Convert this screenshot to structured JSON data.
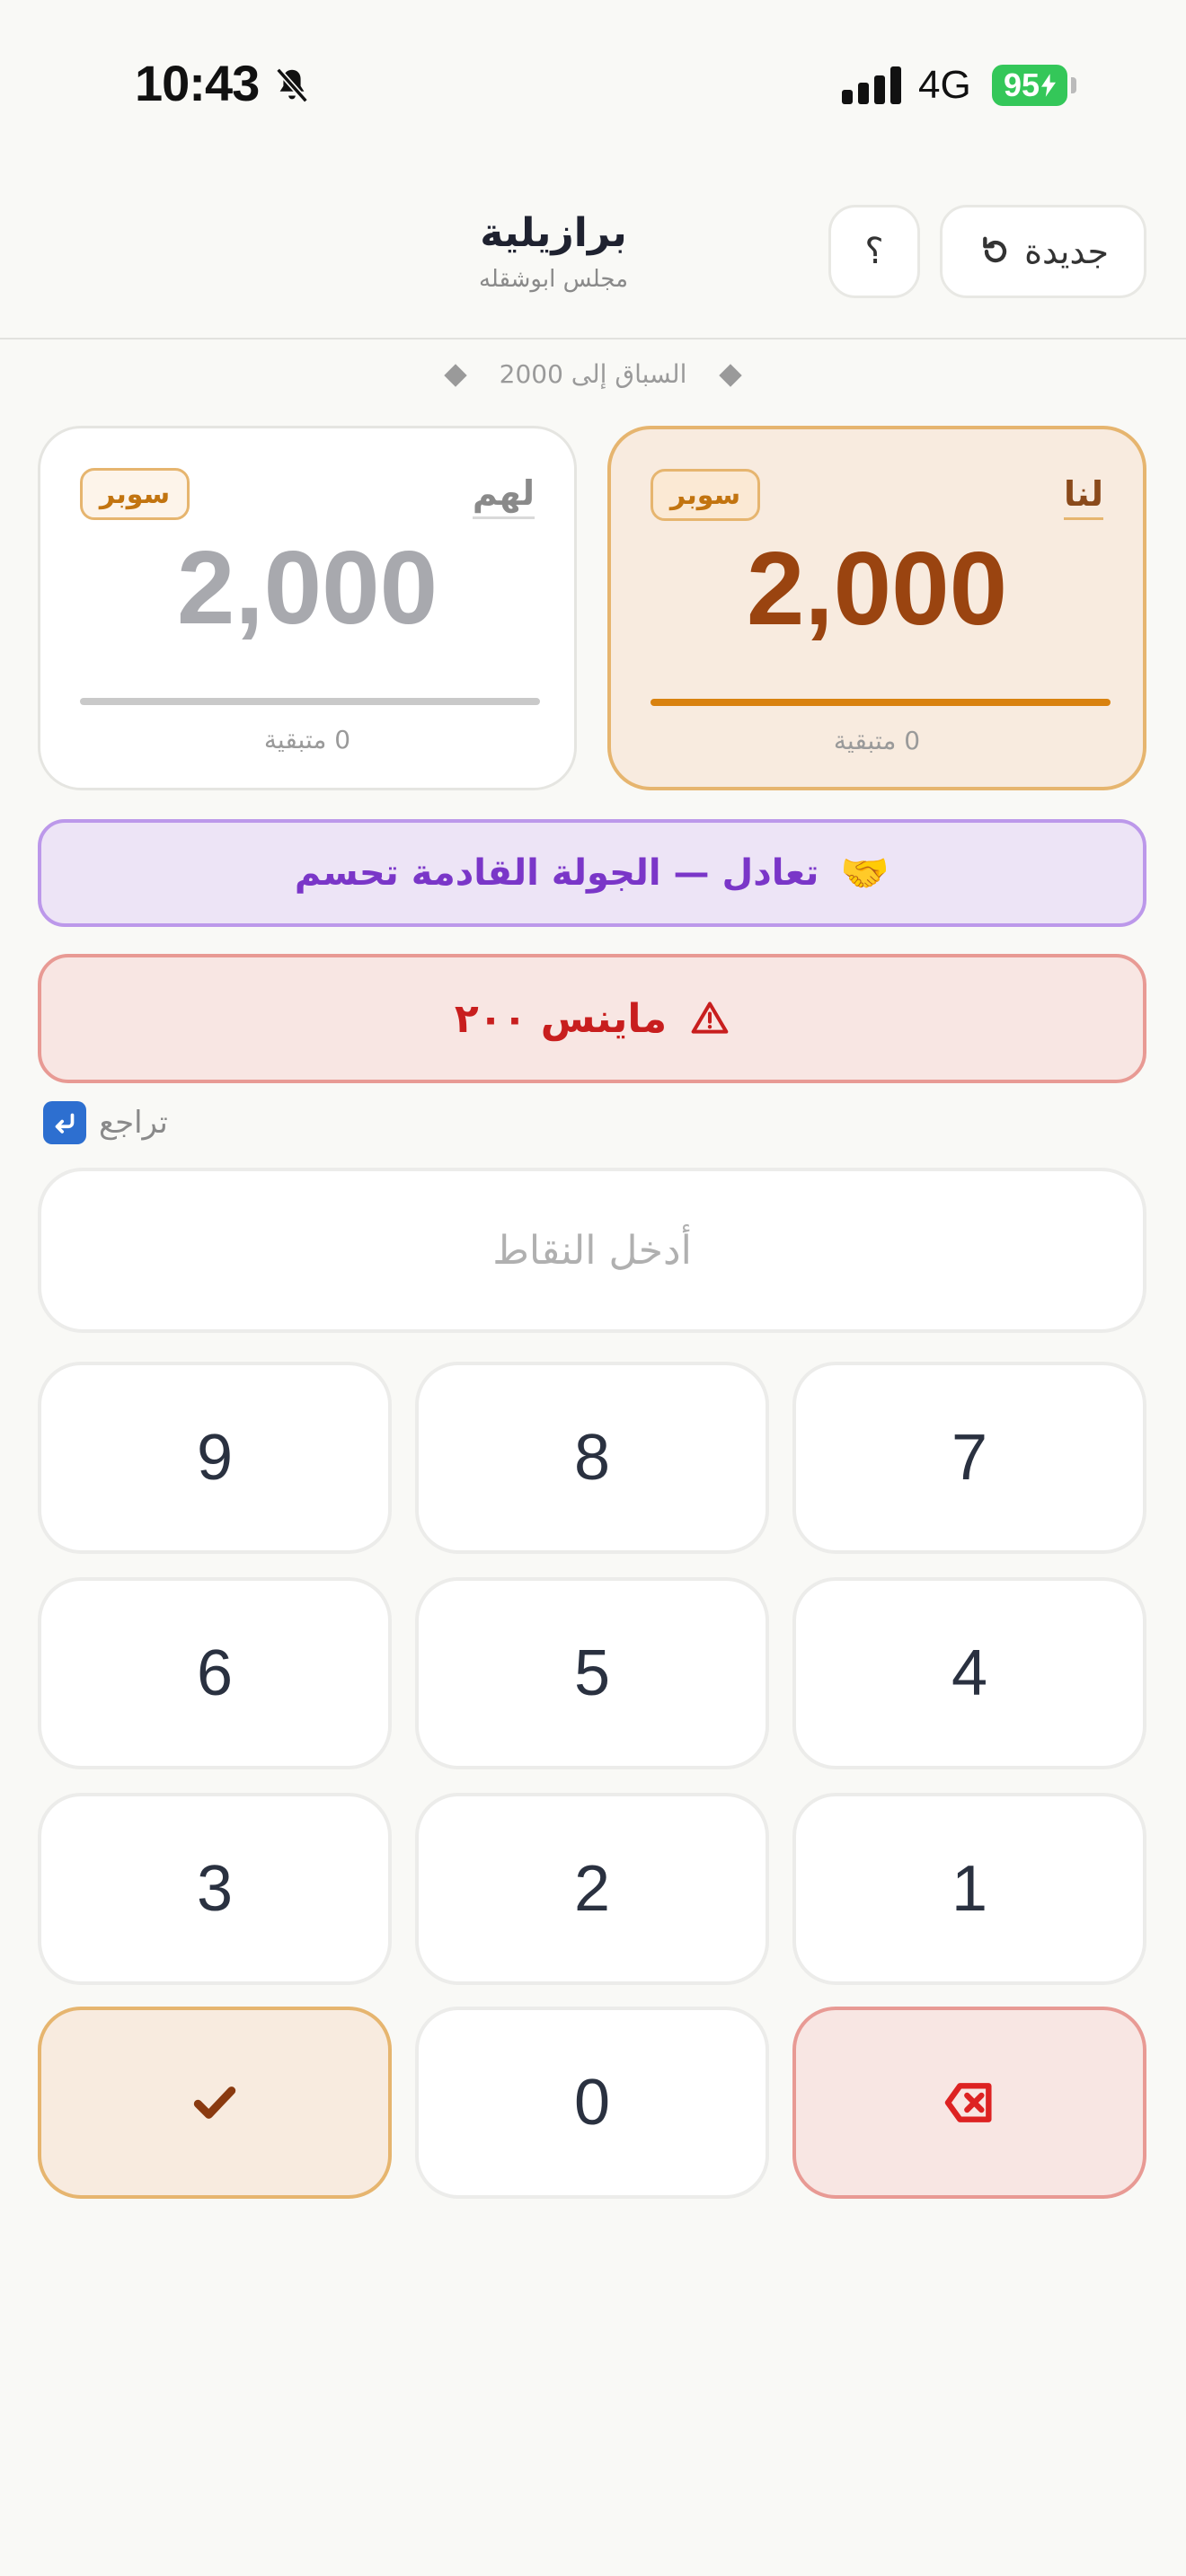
{
  "status": {
    "time": "10:43",
    "network": "4G",
    "battery": "95"
  },
  "header": {
    "title": "برازيلية",
    "subtitle": "مجلس ابوشقله",
    "help_label": "؟",
    "new_label": "جديدة"
  },
  "race": {
    "label": "السباق إلى 2000"
  },
  "cards": {
    "them": {
      "label": "لهم",
      "badge": "سوبر",
      "score": "2,000",
      "remaining": "0 متبقية",
      "progress": 1.0
    },
    "us": {
      "label": "لنا",
      "badge": "سوبر",
      "score": "2,000",
      "remaining": "0 متبقية",
      "progress": 1.0
    }
  },
  "tie_banner": {
    "text": "تعادل — الجولة القادمة تحسم",
    "icon": "🤝"
  },
  "minus_banner": {
    "text": "ماينس ٢٠٠"
  },
  "undo": {
    "label": "تراجع"
  },
  "input": {
    "placeholder": "أدخل النقاط"
  },
  "keypad": {
    "k7": "7",
    "k8": "8",
    "k9": "9",
    "k4": "4",
    "k5": "5",
    "k6": "6",
    "k1": "1",
    "k2": "2",
    "k3": "3",
    "k0": "0"
  },
  "icons": {
    "bell": "bell-slash-icon",
    "refresh": "refresh-icon",
    "warning": "warning-icon",
    "undo": "undo-arrow-icon",
    "backspace": "backspace-icon",
    "confirm": "checkmark-icon"
  },
  "colors": {
    "accent": "#d9820f",
    "us_score": "#9a4410",
    "them_score": "#a8a9ae",
    "tie": "#7a36c8",
    "danger": "#c81e1e"
  }
}
